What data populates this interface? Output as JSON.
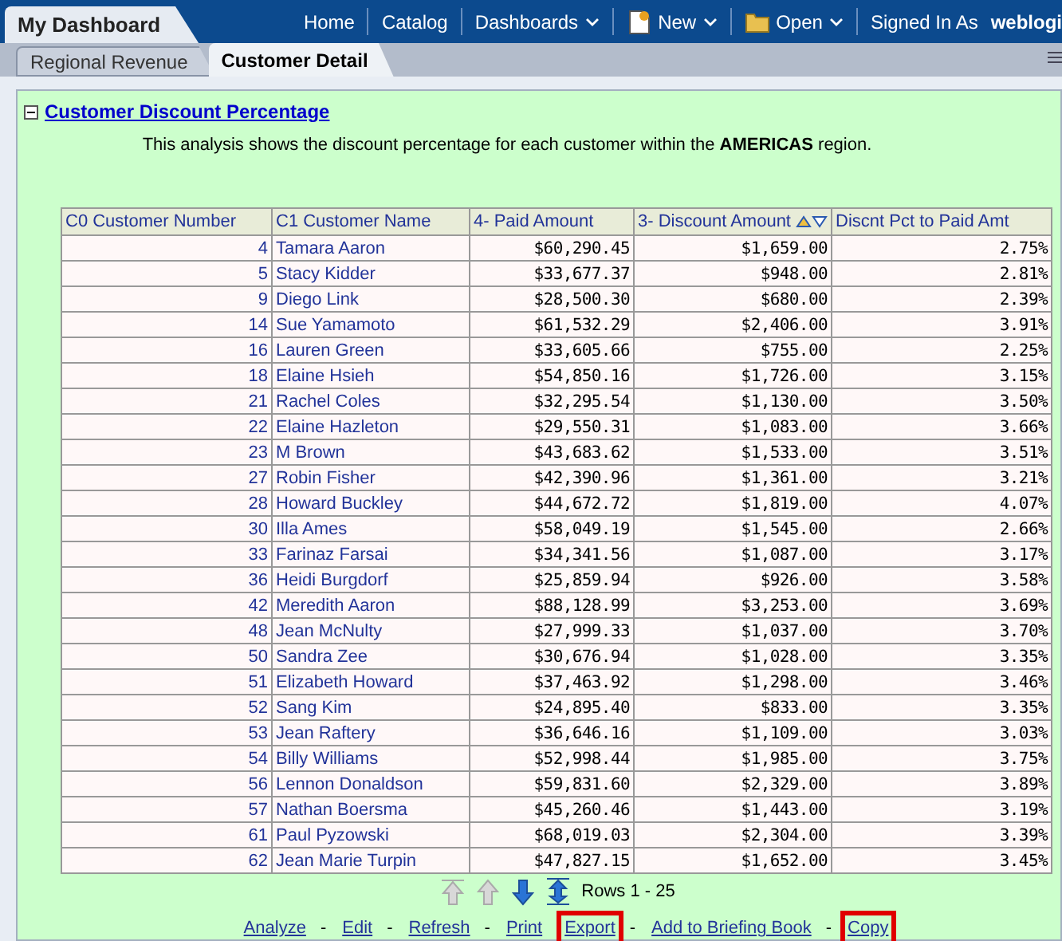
{
  "dashboard_title": "My Dashboard",
  "nav": [
    {
      "label": "Home",
      "kind": "link"
    },
    {
      "label": "Catalog",
      "kind": "link"
    },
    {
      "label": "Dashboards",
      "kind": "menu"
    },
    {
      "label": "New",
      "kind": "new-menu"
    },
    {
      "label": "Open",
      "kind": "open-menu"
    },
    {
      "label": "Signed In As",
      "kind": "user",
      "user": "weblogi"
    }
  ],
  "tabs": [
    {
      "label": "Regional Revenue",
      "selected": false
    },
    {
      "label": "Customer Detail",
      "selected": true
    }
  ],
  "section": {
    "title": "Customer Discount Percentage",
    "expanded": true,
    "description": "This analysis shows the discount percentage for each customer within the **AMERICAS** region."
  },
  "table": {
    "columns": [
      {
        "label": "C0 Customer Number",
        "sort_icon": false
      },
      {
        "label": "C1 Customer Name",
        "sort_icon": false
      },
      {
        "label": "4- Paid Amount",
        "sort_icon": false
      },
      {
        "label": "3- Discount Amount",
        "sort_icon": true
      },
      {
        "label": "Discnt Pct to Paid Amt",
        "sort_icon": false
      }
    ],
    "rows": [
      [
        "4",
        "Tamara Aaron",
        "$60,290.45",
        "$1,659.00",
        "2.75%"
      ],
      [
        "5",
        "Stacy Kidder",
        "$33,677.37",
        "$948.00",
        "2.81%"
      ],
      [
        "9",
        "Diego Link",
        "$28,500.30",
        "$680.00",
        "2.39%"
      ],
      [
        "14",
        "Sue Yamamoto",
        "$61,532.29",
        "$2,406.00",
        "3.91%"
      ],
      [
        "16",
        "Lauren Green",
        "$33,605.66",
        "$755.00",
        "2.25%"
      ],
      [
        "18",
        "Elaine Hsieh",
        "$54,850.16",
        "$1,726.00",
        "3.15%"
      ],
      [
        "21",
        "Rachel Coles",
        "$32,295.54",
        "$1,130.00",
        "3.50%"
      ],
      [
        "22",
        "Elaine Hazleton",
        "$29,550.31",
        "$1,083.00",
        "3.66%"
      ],
      [
        "23",
        "M Brown",
        "$43,683.62",
        "$1,533.00",
        "3.51%"
      ],
      [
        "27",
        "Robin Fisher",
        "$42,390.96",
        "$1,361.00",
        "3.21%"
      ],
      [
        "28",
        "Howard Buckley",
        "$44,672.72",
        "$1,819.00",
        "4.07%"
      ],
      [
        "30",
        "Illa Ames",
        "$58,049.19",
        "$1,545.00",
        "2.66%"
      ],
      [
        "33",
        "Farinaz Farsai",
        "$34,341.56",
        "$1,087.00",
        "3.17%"
      ],
      [
        "36",
        "Heidi Burgdorf",
        "$25,859.94",
        "$926.00",
        "3.58%"
      ],
      [
        "42",
        "Meredith Aaron",
        "$88,128.99",
        "$3,253.00",
        "3.69%"
      ],
      [
        "48",
        "Jean McNulty",
        "$27,999.33",
        "$1,037.00",
        "3.70%"
      ],
      [
        "50",
        "Sandra Zee",
        "$30,676.94",
        "$1,028.00",
        "3.35%"
      ],
      [
        "51",
        "Elizabeth Howard",
        "$37,463.92",
        "$1,298.00",
        "3.46%"
      ],
      [
        "52",
        "Sang Kim",
        "$24,895.40",
        "$833.00",
        "3.35%"
      ],
      [
        "53",
        "Jean Raftery",
        "$36,646.16",
        "$1,109.00",
        "3.03%"
      ],
      [
        "54",
        "Billy Williams",
        "$52,998.44",
        "$1,985.00",
        "3.75%"
      ],
      [
        "56",
        "Lennon Donaldson",
        "$59,831.60",
        "$2,329.00",
        "3.89%"
      ],
      [
        "57",
        "Nathan Boersma",
        "$45,260.46",
        "$1,443.00",
        "3.19%"
      ],
      [
        "61",
        "Paul Pyzowski",
        "$68,019.03",
        "$2,304.00",
        "3.39%"
      ],
      [
        "62",
        "Jean Marie Turpin",
        "$47,827.15",
        "$1,652.00",
        "3.45%"
      ]
    ]
  },
  "pager": {
    "buttons": [
      {
        "kind": "first",
        "disabled": true
      },
      {
        "kind": "prev",
        "disabled": true
      },
      {
        "kind": "next",
        "disabled": false
      },
      {
        "kind": "all",
        "disabled": false
      }
    ],
    "label": "Rows 1 - 25"
  },
  "links": [
    {
      "label": "Analyze",
      "highlighted": false
    },
    {
      "prefix": "-",
      "label": "Edit",
      "highlighted": false
    },
    {
      "prefix": "-",
      "label": "Refresh",
      "highlighted": false
    },
    {
      "prefix": "-",
      "label": "Print",
      "highlighted": false
    },
    {
      "label": "Export",
      "highlighted": true
    },
    {
      "prefix": "-",
      "label": "Add to Briefing Book",
      "highlighted": false
    },
    {
      "prefix": "-",
      "label": "Copy",
      "highlighted": true
    }
  ]
}
